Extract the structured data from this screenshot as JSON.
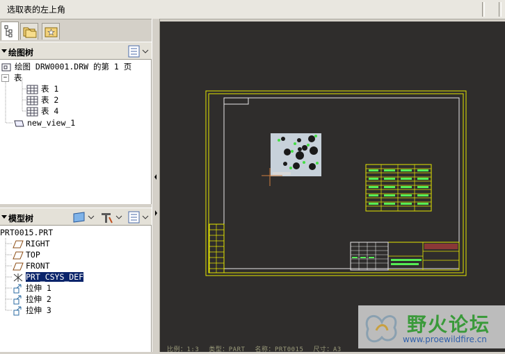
{
  "message_bar": {
    "text": "选取表的左上角"
  },
  "drawing_tree": {
    "title": "绘图树",
    "items": [
      {
        "label": "绘图 DRW0001.DRW 的第 1 页"
      },
      {
        "label": "表"
      },
      {
        "label": "表 1"
      },
      {
        "label": "表 2"
      },
      {
        "label": "表 4"
      },
      {
        "label": "new_view_1"
      }
    ]
  },
  "model_tree": {
    "title": "模型树",
    "root": "PRT0015.PRT",
    "items": [
      {
        "label": "RIGHT",
        "icon": "datum-plane-icon"
      },
      {
        "label": "TOP",
        "icon": "datum-plane-icon"
      },
      {
        "label": "FRONT",
        "icon": "datum-plane-icon"
      },
      {
        "label": "PRT_CSYS_DEF",
        "icon": "csys-icon",
        "selected": true
      },
      {
        "label": "拉伸 1",
        "icon": "extrude-icon"
      },
      {
        "label": "拉伸 2",
        "icon": "extrude-icon"
      },
      {
        "label": "拉伸 3",
        "icon": "extrude-icon"
      }
    ]
  },
  "status": {
    "scale": "比例：1:3",
    "type": "类型：PART",
    "name": "名称：PRT0015",
    "size": "尺寸：A3"
  },
  "watermark": {
    "title": "野火论坛",
    "url": "www.proewildfire.cn"
  },
  "colors": {
    "canvas_bg": "#2f2d2c",
    "frame": "#e6e600",
    "table_fill": "#55ee55",
    "selection": "#0a246a"
  }
}
